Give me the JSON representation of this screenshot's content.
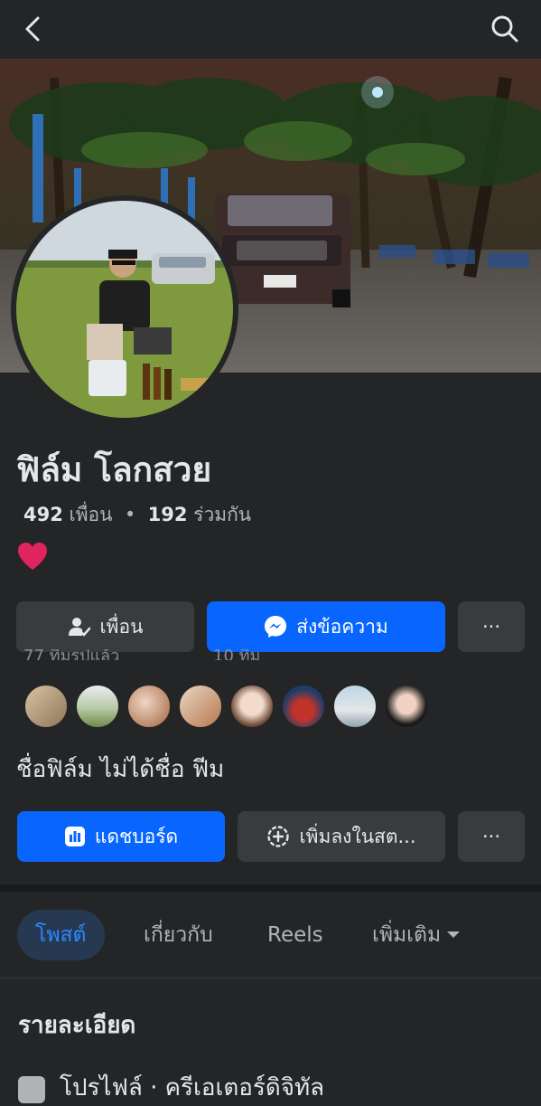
{
  "header": {
    "back_icon": "chevron-left-icon",
    "search_icon": "search-icon"
  },
  "profile": {
    "name": "ฟิล์ม โลกสวย",
    "friends_count": "492",
    "friends_label": "เพื่อน",
    "separator": "•",
    "mutual_count": "192",
    "mutual_label": "ร่วมกัน",
    "status_emoji": "heart",
    "bio": "ชื่อฟิล์ม ไม่ได้ชื่อ ฟีม"
  },
  "actions": {
    "friends_button": "เพื่อน",
    "message_button": "ส่งข้อความ",
    "more_button": "···"
  },
  "peek": {
    "left_text": "77 ทีมรูปแล้ว",
    "right_text": "10 ทีม"
  },
  "dashboard": {
    "dashboard_button": "แดชบอร์ด",
    "add_story_button": "เพิ่มลงในสต...",
    "more_button": "···"
  },
  "tabs": [
    {
      "label": "โพสต์",
      "active": true
    },
    {
      "label": "เกี่ยวกับ",
      "active": false
    },
    {
      "label": "Reels",
      "active": false
    },
    {
      "label": "เพิ่มเติม",
      "active": false
    }
  ],
  "details": {
    "title": "รายละเอียด",
    "first_row": "โปรไฟล์ · ครีเอเตอร์ดิจิทัล"
  },
  "colors": {
    "background": "#242526",
    "primary": "#0866ff",
    "secondary_button": "#3a3b3c",
    "active_tab_bg": "#263951",
    "active_tab_text": "#2d88ff",
    "heart": "#e0245e"
  }
}
